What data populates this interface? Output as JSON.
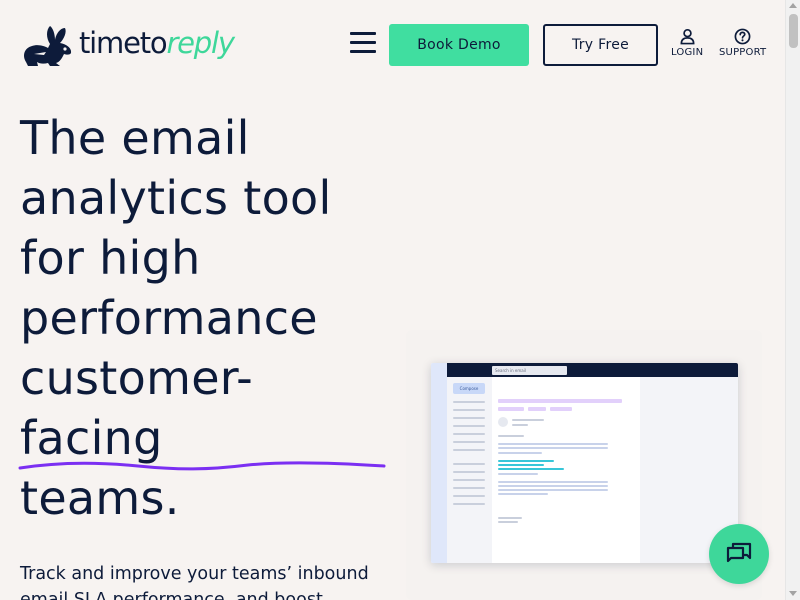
{
  "brand": {
    "logo_part1": "timeto",
    "logo_part2": "reply",
    "accent_color": "#40dea0",
    "text_color": "#0d1b3a",
    "underline_color": "#7b2ff2"
  },
  "nav": {
    "book_demo_label": "Book Demo",
    "try_free_label": "Try Free",
    "login_label": "LOGIN",
    "support_label": "SUPPORT",
    "menu_icon": "hamburger-icon",
    "login_icon": "user-icon",
    "support_icon": "question-icon"
  },
  "hero": {
    "title_lines": [
      "The email",
      "analytics tool",
      "for high",
      "performance",
      "customer-",
      "facing",
      "teams."
    ],
    "subtitle": "Track and improve your teams’ inbound email SLA performance, and boost"
  },
  "mockup": {
    "search_placeholder": "Search in email",
    "compose_label": "Compose"
  },
  "chat": {
    "icon": "chat-bubbles-icon"
  }
}
